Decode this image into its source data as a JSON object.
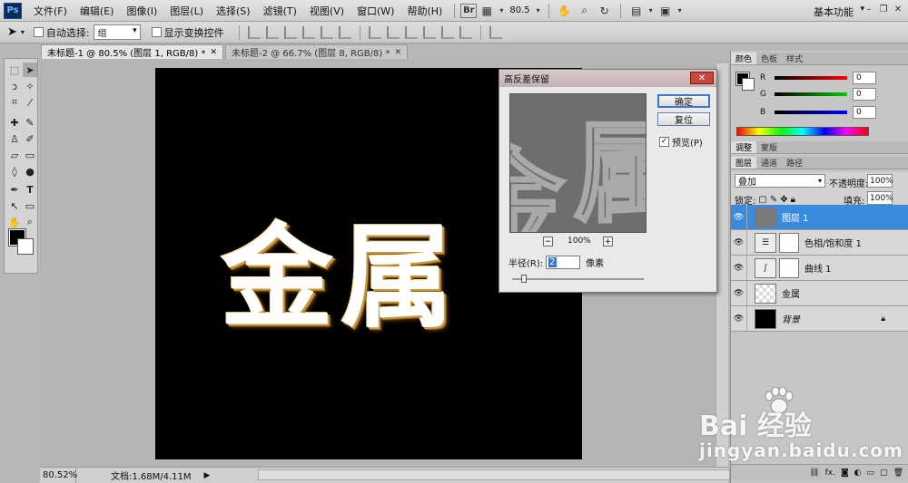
{
  "menubar": {
    "logo": "Ps",
    "items": [
      "文件(F)",
      "编辑(E)",
      "图像(I)",
      "图层(L)",
      "选择(S)",
      "滤镜(T)",
      "视图(V)",
      "窗口(W)",
      "帮助(H)"
    ],
    "br_label": "Br",
    "zoom": "80.5",
    "workspace": "基本功能"
  },
  "options": {
    "auto_select_label": "自动选择:",
    "auto_select_value": "组",
    "show_transform_label": "显示变换控件"
  },
  "tabs": [
    {
      "label": "未标题-1 @ 80.5% (图层 1, RGB/8) *"
    },
    {
      "label": "未标题-2 @ 66.7% (图层 8, RGB/8) *"
    }
  ],
  "canvas": {
    "text": "金属"
  },
  "status": {
    "zoom": "80.52%",
    "doc": "文档:1.68M/4.11M"
  },
  "dialog": {
    "title": "高反差保留",
    "ok": "确定",
    "reset": "复位",
    "preview": "预览(P)",
    "preview_pct": "100%",
    "radius_label": "半径(R):",
    "radius_value": "2",
    "radius_unit": "像素",
    "preview_glyph_a": "金",
    "preview_glyph_b": "属"
  },
  "color_panel": {
    "tabs": [
      "颜色",
      "色板",
      "样式"
    ],
    "r_label": "R",
    "r_value": "0",
    "g_label": "G",
    "g_value": "0",
    "b_label": "B",
    "b_value": "0"
  },
  "adjust_panel": {
    "tabs": [
      "调整",
      "蒙版"
    ]
  },
  "layers_panel": {
    "tabs": [
      "图层",
      "通道",
      "路径"
    ],
    "blend_mode": "叠加",
    "opacity_label": "不透明度:",
    "opacity_value": "100%",
    "lock_label": "锁定:",
    "fill_label": "填充:",
    "fill_value": "100%",
    "layers": [
      {
        "name": "图层 1"
      },
      {
        "name": "色相/饱和度 1"
      },
      {
        "name": "曲线 1"
      },
      {
        "name": "金属"
      },
      {
        "name": "背景"
      }
    ]
  },
  "watermark": {
    "text": "Bai 经验",
    "url": "jingyan.baidu.com"
  }
}
